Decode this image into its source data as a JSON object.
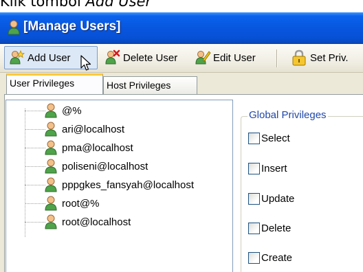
{
  "caption": {
    "prefix": "Klik tombol ",
    "emphasis": "Add User"
  },
  "window": {
    "title": "[Manage Users]"
  },
  "toolbar": {
    "add_user": "Add User",
    "delete_user": "Delete User",
    "edit_user": "Edit User",
    "set_priv": "Set Priv."
  },
  "tabs": {
    "user_privileges": "User Privileges",
    "host_privileges": "Host Privileges"
  },
  "users": [
    "@%",
    "ari@localhost",
    "pma@localhost",
    "poliseni@localhost",
    "pppgkes_fansyah@localhost",
    "root@%",
    "root@localhost"
  ],
  "global_privileges": {
    "title": "Global Privileges",
    "options": [
      "Select",
      "Insert",
      "Update",
      "Delete",
      "Create"
    ]
  },
  "colors": {
    "titlebar": "#0855dd",
    "legend_text": "#1f46a8",
    "active_tab_accent": "#ffc83c",
    "user_icon": "#4fa34a"
  }
}
